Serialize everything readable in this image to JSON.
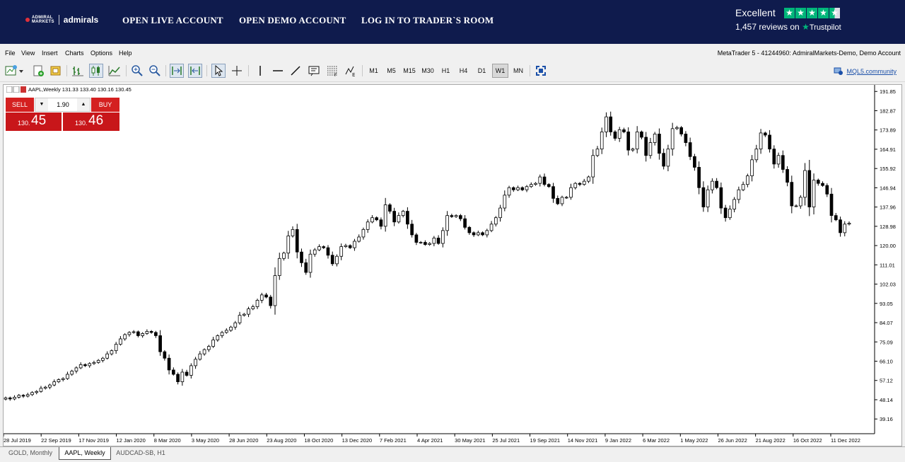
{
  "banner": {
    "logo_top": "ADMIRAL",
    "logo_bottom": "MARKETS",
    "logo_name": "admirals",
    "links": [
      "OPEN LIVE ACCOUNT",
      "OPEN DEMO ACCOUNT",
      "LOG IN TO TRADER`S ROOM"
    ],
    "trustpilot": {
      "rating_label": "Excellent",
      "reviews": "1,457 reviews on",
      "brand": "Trustpilot",
      "stars": 4.5
    }
  },
  "menu": {
    "items": [
      "File",
      "View",
      "Insert",
      "Charts",
      "Options",
      "Help"
    ],
    "terminal_title": "MetaTrader 5 - 41244960: AdmiralMarkets-Demo, Demo Account"
  },
  "toolbar": {
    "timeframes": [
      "M1",
      "M5",
      "M15",
      "M30",
      "H1",
      "H4",
      "D1",
      "W1",
      "MN"
    ],
    "active_timeframe": "W1",
    "mql_label": "MQL5.community"
  },
  "chart": {
    "symbol_info": "AAPL,Weekly  131.33 133.40 130.16 130.45",
    "trade": {
      "sell_label": "SELL",
      "buy_label": "BUY",
      "lot": "1.90",
      "bid_small": "130.",
      "bid_big": "45",
      "ask_small": "130.",
      "ask_big": "46"
    }
  },
  "chart_data": {
    "type": "candlestick",
    "symbol": "AAPL",
    "period": "Weekly",
    "ylim": [
      32.3,
      194.9
    ],
    "y_ticks": [
      191.85,
      182.87,
      173.89,
      164.91,
      155.92,
      146.94,
      137.96,
      128.98,
      120.0,
      111.01,
      102.03,
      93.05,
      84.07,
      75.09,
      66.1,
      57.12,
      48.14,
      39.16
    ],
    "x_tick_labels": [
      "28 Jul 2019",
      "22 Sep 2019",
      "17 Nov 2019",
      "12 Jan 2020",
      "8 Mar 2020",
      "3 May 2020",
      "28 Jun 2020",
      "23 Aug 2020",
      "18 Oct 2020",
      "13 Dec 2020",
      "7 Feb 2021",
      "4 Apr 2021",
      "30 May 2021",
      "25 Jul 2021",
      "19 Sep 2021",
      "14 Nov 2021",
      "9 Jan 2022",
      "6 Mar 2022",
      "1 May 2022",
      "26 Jun 2022",
      "21 Aug 2022",
      "16 Oct 2022",
      "11 Dec 2022"
    ],
    "closes": [
      49.0,
      48.5,
      49.3,
      50.2,
      49.8,
      50.5,
      51.5,
      52.0,
      53.5,
      54.0,
      55.0,
      56.5,
      57.5,
      58.0,
      60.0,
      61.5,
      63.0,
      64.5,
      64.0,
      65.0,
      65.5,
      66.5,
      67.5,
      69.5,
      71.0,
      74.0,
      76.5,
      78.5,
      79.5,
      79.8,
      78.0,
      79.0,
      80.0,
      79.5,
      78.0,
      70.5,
      67.5,
      62.0,
      60.0,
      56.5,
      61.0,
      59.5,
      64.0,
      67.0,
      69.5,
      71.5,
      73.0,
      76.0,
      78.0,
      79.5,
      80.5,
      82.0,
      84.0,
      87.5,
      88.0,
      90.5,
      91.5,
      94.5,
      97.0,
      96.0,
      92.0,
      106.0,
      114.0,
      116.5,
      124.5,
      127.5,
      117.0,
      112.0,
      107.5,
      116.0,
      118.0,
      119.5,
      119.0,
      115.5,
      111.5,
      115.0,
      119.5,
      120.0,
      119.0,
      122.0,
      124.0,
      127.5,
      131.0,
      133.0,
      132.0,
      129.0,
      139.0,
      136.0,
      131.0,
      134.0,
      136.0,
      130.0,
      125.0,
      121.5,
      121.5,
      120.5,
      121.0,
      123.5,
      121.0,
      127.0,
      134.0,
      133.5,
      134.0,
      132.5,
      128.5,
      126.0,
      125.0,
      126.0,
      125.0,
      127.0,
      130.0,
      133.0,
      137.5,
      143.5,
      147.0,
      146.0,
      147.0,
      146.0,
      147.5,
      148.5,
      149.0,
      152.0,
      148.5,
      147.5,
      142.0,
      139.5,
      142.5,
      142.5,
      147.0,
      149.0,
      148.5,
      150.0,
      152.0,
      162.0,
      165.0,
      173.0,
      180.0,
      173.0,
      170.0,
      174.0,
      173.0,
      164.5,
      165.0,
      173.0,
      170.5,
      162.0,
      168.0,
      172.0,
      163.0,
      157.0,
      165.0,
      174.5,
      175.0,
      172.0,
      168.0,
      161.5,
      156.5,
      147.0,
      138.0,
      146.0,
      150.0,
      147.0,
      137.5,
      133.0,
      137.0,
      141.5,
      146.0,
      148.5,
      152.5,
      160.0,
      165.0,
      172.5,
      171.5,
      165.0,
      158.0,
      162.0,
      155.5,
      149.5,
      138.5,
      138.5,
      142.5,
      155.0,
      138.0,
      150.5,
      149.0,
      148.0,
      144.0,
      134.0,
      132.0,
      126.0,
      130.0,
      130.45
    ]
  }
}
